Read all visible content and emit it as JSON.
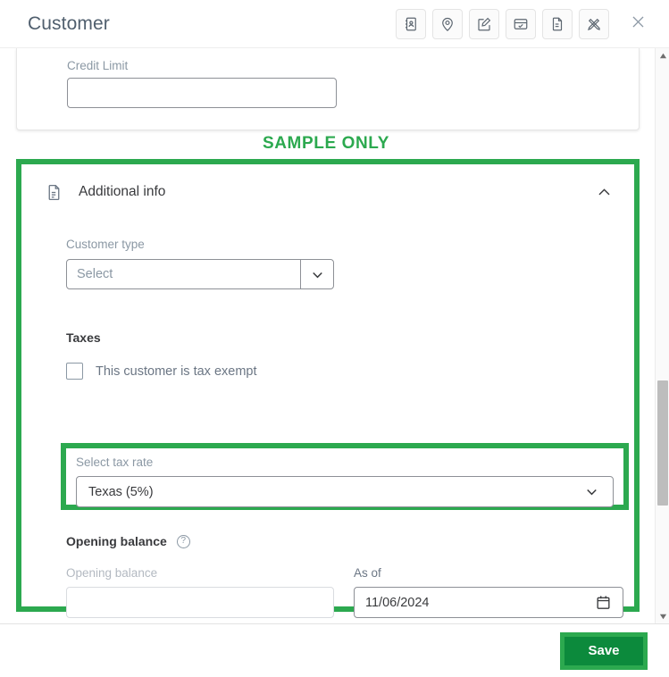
{
  "header": {
    "title": "Customer",
    "actions": [
      {
        "name": "address-book-icon",
        "label": "Address book"
      },
      {
        "name": "location-pin-icon",
        "label": "Location"
      },
      {
        "name": "edit-square-icon",
        "label": "Edit"
      },
      {
        "name": "card-check-icon",
        "label": "Payment card"
      },
      {
        "name": "document-icon",
        "label": "Document"
      },
      {
        "name": "design-tools-icon",
        "label": "Design tools"
      }
    ],
    "close_label": "Close"
  },
  "credit_limit": {
    "label": "Credit Limit",
    "value": "",
    "placeholder": ""
  },
  "banner": {
    "text": "SAMPLE ONLY"
  },
  "additional_info": {
    "title": "Additional info",
    "collapse_label": "Collapse",
    "customer_type": {
      "label": "Customer type",
      "value": "Select",
      "placeholder": "Select"
    },
    "taxes": {
      "heading": "Taxes",
      "exempt_label": "This customer is tax exempt",
      "exempt_checked": false,
      "tax_rate": {
        "label": "Select tax rate",
        "value": "Texas (5%)"
      }
    },
    "opening_balance": {
      "heading": "Opening balance",
      "help_glyph": "?",
      "balance_label": "Opening balance",
      "balance_value": "",
      "as_of_label": "As of",
      "as_of_value": "11/06/2024"
    }
  },
  "footer": {
    "save_label": "Save"
  },
  "scrollbar": {
    "up_glyph": "▲",
    "down_glyph": "▼"
  },
  "colors": {
    "highlight_green": "#2CA94F",
    "save_green": "#0C8A3C",
    "text_dark": "#393a3d",
    "text_muted": "#8b98a4"
  }
}
